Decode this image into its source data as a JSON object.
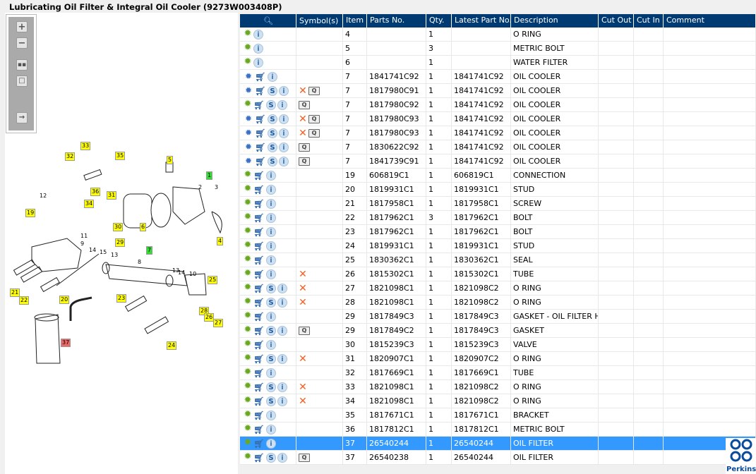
{
  "title": "Lubricating Oil Filter & Integral Oil Cooler (9273W003408P)",
  "toolbar": [
    "zoom-in",
    "zoom-out",
    "fit-all",
    "fit-window",
    "export"
  ],
  "headers": {
    "c0": "",
    "c1": "Symbol(s)",
    "c2": "Item",
    "c3": "Parts No.",
    "c4": "Qty.",
    "c5": "Latest Part No.",
    "c6": "Description",
    "c7": "Cut Out",
    "c8": "Cut In",
    "c9": "Comment"
  },
  "rows": [
    {
      "icons": [
        "gear",
        "i"
      ],
      "sym": [],
      "item": "4",
      "part": "",
      "qty": "1",
      "latest": "",
      "desc": "O RING"
    },
    {
      "icons": [
        "gear",
        "i"
      ],
      "sym": [],
      "item": "5",
      "part": "",
      "qty": "3",
      "latest": "",
      "desc": "METRIC BOLT"
    },
    {
      "icons": [
        "gear",
        "i"
      ],
      "sym": [],
      "item": "6",
      "part": "",
      "qty": "1",
      "latest": "",
      "desc": "WATER FILTER"
    },
    {
      "icons": [
        "gears",
        "cart",
        "i"
      ],
      "sym": [],
      "item": "7",
      "part": "1841741C92",
      "qty": "1",
      "latest": "1841741C92",
      "desc": "OIL COOLER"
    },
    {
      "icons": [
        "gears",
        "cart",
        "s",
        "i"
      ],
      "sym": [
        "x",
        "book"
      ],
      "item": "7",
      "part": "1817980C91",
      "qty": "1",
      "latest": "1841741C92",
      "desc": "OIL COOLER"
    },
    {
      "icons": [
        "gear",
        "cart",
        "s",
        "i"
      ],
      "sym": [
        "book"
      ],
      "item": "7",
      "part": "1817980C92",
      "qty": "1",
      "latest": "1841741C92",
      "desc": "OIL COOLER"
    },
    {
      "icons": [
        "gears",
        "cart",
        "s",
        "i"
      ],
      "sym": [
        "x",
        "book"
      ],
      "item": "7",
      "part": "1817980C93",
      "qty": "1",
      "latest": "1841741C92",
      "desc": "OIL COOLER"
    },
    {
      "icons": [
        "gears",
        "cart",
        "s",
        "i"
      ],
      "sym": [
        "x",
        "book"
      ],
      "item": "7",
      "part": "1817980C93",
      "qty": "1",
      "latest": "1841741C92",
      "desc": "OIL COOLER"
    },
    {
      "icons": [
        "gears",
        "cart",
        "s",
        "i"
      ],
      "sym": [
        "book"
      ],
      "item": "7",
      "part": "1830622C92",
      "qty": "1",
      "latest": "1841741C92",
      "desc": "OIL COOLER"
    },
    {
      "icons": [
        "gears",
        "cart",
        "s",
        "i"
      ],
      "sym": [
        "book"
      ],
      "item": "7",
      "part": "1841739C91",
      "qty": "1",
      "latest": "1841741C92",
      "desc": "OIL COOLER"
    },
    {
      "icons": [
        "gear",
        "cart",
        "i"
      ],
      "sym": [],
      "item": "19",
      "part": "606819C1",
      "qty": "1",
      "latest": "606819C1",
      "desc": "CONNECTION"
    },
    {
      "icons": [
        "gear",
        "cart",
        "i"
      ],
      "sym": [],
      "item": "20",
      "part": "1819931C1",
      "qty": "1",
      "latest": "1819931C1",
      "desc": "STUD"
    },
    {
      "icons": [
        "gear",
        "cart",
        "i"
      ],
      "sym": [],
      "item": "21",
      "part": "1817958C1",
      "qty": "1",
      "latest": "1817958C1",
      "desc": "SCREW"
    },
    {
      "icons": [
        "gear",
        "cart",
        "i"
      ],
      "sym": [],
      "item": "22",
      "part": "1817962C1",
      "qty": "3",
      "latest": "1817962C1",
      "desc": "BOLT"
    },
    {
      "icons": [
        "gear",
        "cart",
        "i"
      ],
      "sym": [],
      "item": "23",
      "part": "1817962C1",
      "qty": "1",
      "latest": "1817962C1",
      "desc": "BOLT"
    },
    {
      "icons": [
        "gear",
        "cart",
        "i"
      ],
      "sym": [],
      "item": "24",
      "part": "1819931C1",
      "qty": "1",
      "latest": "1819931C1",
      "desc": "STUD"
    },
    {
      "icons": [
        "gear",
        "cart",
        "i"
      ],
      "sym": [],
      "item": "25",
      "part": "1830362C1",
      "qty": "1",
      "latest": "1830362C1",
      "desc": "SEAL"
    },
    {
      "icons": [
        "gear",
        "cart",
        "i"
      ],
      "sym": [
        "x"
      ],
      "item": "26",
      "part": "1815302C1",
      "qty": "1",
      "latest": "1815302C1",
      "desc": "TUBE"
    },
    {
      "icons": [
        "gear",
        "cart",
        "s",
        "i"
      ],
      "sym": [
        "x"
      ],
      "item": "27",
      "part": "1821098C1",
      "qty": "1",
      "latest": "1821098C2",
      "desc": "O RING"
    },
    {
      "icons": [
        "gear",
        "cart",
        "s",
        "i"
      ],
      "sym": [
        "x"
      ],
      "item": "28",
      "part": "1821098C1",
      "qty": "1",
      "latest": "1821098C2",
      "desc": "O RING"
    },
    {
      "icons": [
        "gear",
        "cart",
        "i"
      ],
      "sym": [],
      "item": "29",
      "part": "1817849C3",
      "qty": "1",
      "latest": "1817849C3",
      "desc": "GASKET - OIL FILTER HEA"
    },
    {
      "icons": [
        "gear",
        "cart",
        "s",
        "i"
      ],
      "sym": [
        "book"
      ],
      "item": "29",
      "part": "1817849C2",
      "qty": "1",
      "latest": "1817849C3",
      "desc": "GASKET"
    },
    {
      "icons": [
        "gear",
        "cart",
        "i"
      ],
      "sym": [],
      "item": "30",
      "part": "1815239C3",
      "qty": "1",
      "latest": "1815239C3",
      "desc": "VALVE"
    },
    {
      "icons": [
        "gear",
        "cart",
        "s",
        "i"
      ],
      "sym": [
        "x"
      ],
      "item": "31",
      "part": "1820907C1",
      "qty": "1",
      "latest": "1820907C2",
      "desc": "O RING"
    },
    {
      "icons": [
        "gear",
        "cart",
        "i"
      ],
      "sym": [],
      "item": "32",
      "part": "1817669C1",
      "qty": "1",
      "latest": "1817669C1",
      "desc": "TUBE"
    },
    {
      "icons": [
        "gear",
        "cart",
        "s",
        "i"
      ],
      "sym": [
        "x"
      ],
      "item": "33",
      "part": "1821098C1",
      "qty": "1",
      "latest": "1821098C2",
      "desc": "O RING"
    },
    {
      "icons": [
        "gear",
        "cart",
        "s",
        "i"
      ],
      "sym": [
        "x"
      ],
      "item": "34",
      "part": "1821098C1",
      "qty": "1",
      "latest": "1821098C2",
      "desc": "O RING"
    },
    {
      "icons": [
        "gear",
        "cart",
        "i"
      ],
      "sym": [],
      "item": "35",
      "part": "1817671C1",
      "qty": "1",
      "latest": "1817671C1",
      "desc": "BRACKET"
    },
    {
      "icons": [
        "gear",
        "cart",
        "i"
      ],
      "sym": [],
      "item": "36",
      "part": "1817812C1",
      "qty": "1",
      "latest": "1817812C1",
      "desc": "METRIC BOLT"
    },
    {
      "icons": [
        "gear",
        "cart",
        "i"
      ],
      "sym": [],
      "item": "37",
      "part": "26540244",
      "qty": "1",
      "latest": "26540244",
      "desc": "OIL FILTER",
      "selected": true
    },
    {
      "icons": [
        "gear",
        "cart",
        "s",
        "i"
      ],
      "sym": [
        "book"
      ],
      "item": "37",
      "part": "26540238",
      "qty": "1",
      "latest": "26540244",
      "desc": "OIL FILTER"
    }
  ],
  "callouts": [
    {
      "t": "33",
      "c": "#ffff00"
    },
    {
      "t": "32",
      "c": "#ffff00"
    },
    {
      "t": "35",
      "c": "#ffff00"
    },
    {
      "t": "5",
      "c": "#ffff00"
    },
    {
      "t": "1",
      "c": "#33dd33"
    },
    {
      "t": "36",
      "c": "#ffff00"
    },
    {
      "t": "31",
      "c": "#ffff00"
    },
    {
      "t": "34",
      "c": "#ffff00"
    },
    {
      "t": "30",
      "c": "#ffff00"
    },
    {
      "t": "6",
      "c": "#ffff00"
    },
    {
      "t": "19",
      "c": "#ffff00"
    },
    {
      "t": "29",
      "c": "#ffff00"
    },
    {
      "t": "4",
      "c": "#ffff00"
    },
    {
      "t": "7",
      "c": "#33dd33"
    },
    {
      "t": "25",
      "c": "#ffff00"
    },
    {
      "t": "21",
      "c": "#ffff00"
    },
    {
      "t": "22",
      "c": "#ffff00"
    },
    {
      "t": "20",
      "c": "#ffff00"
    },
    {
      "t": "23",
      "c": "#ffff00"
    },
    {
      "t": "28",
      "c": "#ffff00"
    },
    {
      "t": "26",
      "c": "#ffff00"
    },
    {
      "t": "27",
      "c": "#ffff00"
    },
    {
      "t": "24",
      "c": "#ffff00"
    },
    {
      "t": "37",
      "c": "#ee6666"
    }
  ],
  "plain_labels": [
    "12",
    "2",
    "3",
    "11",
    "9",
    "14",
    "15",
    "13",
    "8",
    "10",
    "13",
    "14"
  ],
  "logo": "Perkins"
}
